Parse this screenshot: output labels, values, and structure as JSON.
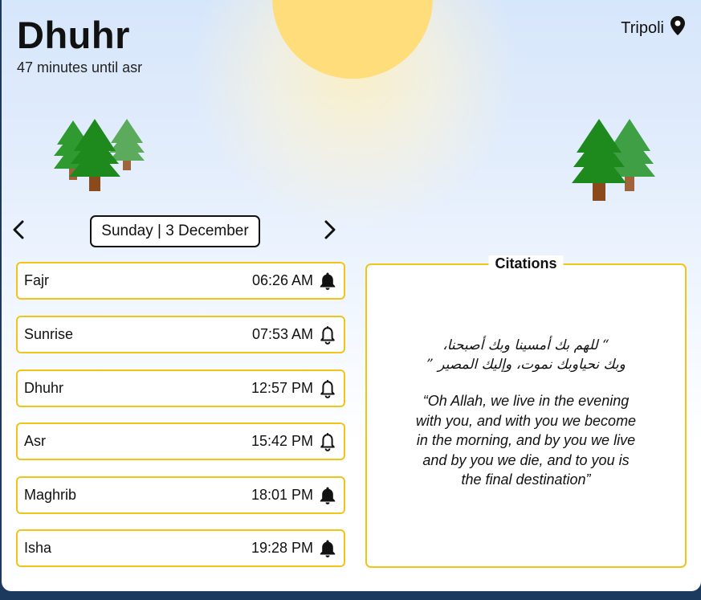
{
  "header": {
    "current_prayer": "Dhuhr",
    "countdown": "47 minutes until asr",
    "location": "Tripoli",
    "location_icon": "location-pin-icon"
  },
  "date_nav": {
    "label": "Sunday | 3 December",
    "prev_icon": "chevron-left-icon",
    "next_icon": "chevron-right-icon"
  },
  "prayers": [
    {
      "name": "Fajr",
      "time": "06:26 AM",
      "bell": "filled"
    },
    {
      "name": "Sunrise",
      "time": "07:53 AM",
      "bell": "outline"
    },
    {
      "name": "Dhuhr",
      "time": "12:57 PM",
      "bell": "outline"
    },
    {
      "name": "Asr",
      "time": "15:42 PM",
      "bell": "outline"
    },
    {
      "name": "Maghrib",
      "time": "18:01 PM",
      "bell": "filled"
    },
    {
      "name": "Isha",
      "time": "19:28 PM",
      "bell": "filled"
    }
  ],
  "citations": {
    "title": "Citations",
    "arabic_line1": "“ للهم بك أمسينا وبك أصبحنا،",
    "arabic_line2": "وبك نحياوبك نموت، وإليك المصير ”",
    "english": "“Oh Allah, we live in the evening with you, and with you we become in the morning, and by you we live and by you we die, and to you is the final destination”"
  },
  "colors": {
    "accent_border": "#f0c419",
    "sun": "#ffdd7a",
    "tree_dark": "#1e8a1e",
    "tree_light": "#4fa352",
    "trunk": "#8b4a1c"
  }
}
